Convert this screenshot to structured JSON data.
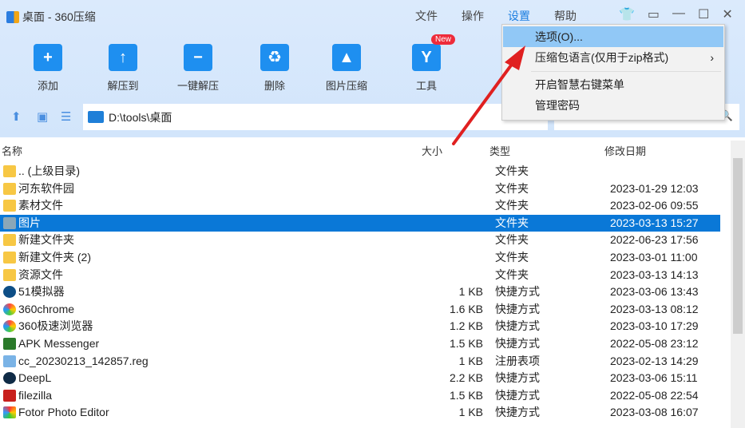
{
  "window": {
    "title": "桌面 - 360压缩"
  },
  "menubar": [
    "文件",
    "操作",
    "设置",
    "帮助"
  ],
  "toolbar": [
    {
      "label": "添加",
      "glyph": "+"
    },
    {
      "label": "解压到",
      "glyph": "↑"
    },
    {
      "label": "一键解压",
      "glyph": "−"
    },
    {
      "label": "删除",
      "glyph": "♻"
    },
    {
      "label": "图片压缩",
      "glyph": "▲"
    },
    {
      "label": "工具",
      "glyph": "Y",
      "badge": "New"
    }
  ],
  "address": {
    "path": "D:\\tools\\桌面"
  },
  "columns": {
    "name": "名称",
    "size": "大小",
    "type": "类型",
    "date": "修改日期"
  },
  "files": [
    {
      "name": ".. (上级目录)",
      "size": "",
      "type": "文件夹",
      "date": "",
      "icon": "folder"
    },
    {
      "name": "河东软件园",
      "size": "",
      "type": "文件夹",
      "date": "2023-01-29 12:03",
      "icon": "folder"
    },
    {
      "name": "素材文件",
      "size": "",
      "type": "文件夹",
      "date": "2023-02-06 09:55",
      "icon": "folder"
    },
    {
      "name": "图片",
      "size": "",
      "type": "文件夹",
      "date": "2023-03-13 15:27",
      "icon": "folder",
      "selected": true
    },
    {
      "name": "新建文件夹",
      "size": "",
      "type": "文件夹",
      "date": "2022-06-23 17:56",
      "icon": "folder"
    },
    {
      "name": "新建文件夹 (2)",
      "size": "",
      "type": "文件夹",
      "date": "2023-03-01 11:00",
      "icon": "folder"
    },
    {
      "name": "资源文件",
      "size": "",
      "type": "文件夹",
      "date": "2023-03-13 14:13",
      "icon": "folder"
    },
    {
      "name": "51模拟器",
      "size": "1 KB",
      "type": "快捷方式",
      "date": "2023-03-06 13:43",
      "icon": "app-51"
    },
    {
      "name": "360chrome",
      "size": "1.6 KB",
      "type": "快捷方式",
      "date": "2023-03-13 08:12",
      "icon": "browser"
    },
    {
      "name": "360极速浏览器",
      "size": "1.2 KB",
      "type": "快捷方式",
      "date": "2023-03-10 17:29",
      "icon": "browser"
    },
    {
      "name": "APK Messenger",
      "size": "1.5 KB",
      "type": "快捷方式",
      "date": "2022-05-08 23:12",
      "icon": "apk"
    },
    {
      "name": "cc_20230213_142857.reg",
      "size": "1 KB",
      "type": "注册表项",
      "date": "2023-02-13 14:29",
      "icon": "reg"
    },
    {
      "name": "DeepL",
      "size": "2.2 KB",
      "type": "快捷方式",
      "date": "2023-03-06 15:11",
      "icon": "deepl"
    },
    {
      "name": "filezilla",
      "size": "1.5 KB",
      "type": "快捷方式",
      "date": "2022-05-08 22:54",
      "icon": "filezilla"
    },
    {
      "name": "Fotor Photo Editor",
      "size": "1 KB",
      "type": "快捷方式",
      "date": "2023-03-08 16:07",
      "icon": "fotor"
    }
  ],
  "settings_menu": {
    "items": [
      "选项(O)...",
      "压缩包语言(仅用于zip格式)",
      "开启智慧右键菜单",
      "管理密码"
    ],
    "submenu_arrow": "›"
  },
  "colors": {
    "selection": "#0a78d7",
    "accent": "#1a7de0",
    "arrow": "#e02020"
  }
}
